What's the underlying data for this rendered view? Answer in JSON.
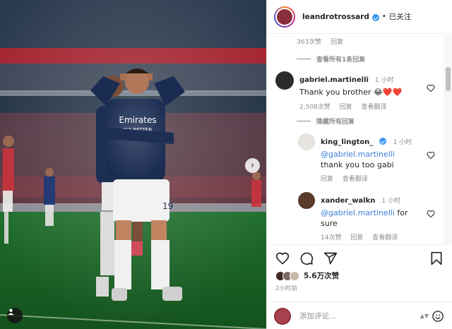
{
  "post": {
    "username": "leandrotrossard",
    "separator": "•",
    "follow_status": "已关注"
  },
  "comments": {
    "top_meta": {
      "likes": "363次赞",
      "reply": "回复"
    },
    "view_replies": "查看所有1条回复",
    "martinelli": {
      "username": "gabriel.martinelli",
      "time": "1 小时",
      "text": "Thank you brother",
      "emojis": "😂❤️❤️",
      "likes": "2,508次赞",
      "reply": "回复",
      "translate": "查看翻译"
    },
    "hide_replies": "隐藏所有回复",
    "lington": {
      "username": "king_lington_",
      "time": "1 小时",
      "mention": "@gabriel.martinelli",
      "text": "thank you too gabi",
      "reply": "回复",
      "translate": "查看翻译"
    },
    "walkn": {
      "username": "xander_walkn",
      "time": "1 小时",
      "mention": "@gabriel.martinelli",
      "text_after_mention": "for",
      "text_second_line": "sure",
      "likes": "14次赞",
      "reply": "回复",
      "translate": "查看翻译"
    }
  },
  "actions": {
    "likes_total": "5.6万次赞",
    "posted": "2小时前",
    "comment_placeholder": "添加评论..."
  },
  "photo": {
    "sponsor_text": "Emirates",
    "sponsor_sub": "FLY BETTER",
    "shirt_number": "19"
  },
  "colors": {
    "accent": "#3897f0",
    "mention": "#3a7fd6",
    "like_red": "#ed4956"
  },
  "icons": [
    "heart-icon",
    "comment-icon",
    "share-icon",
    "bookmark-icon",
    "chevron-right-icon",
    "user-tag-icon",
    "emoji-icon",
    "verified-icon"
  ]
}
